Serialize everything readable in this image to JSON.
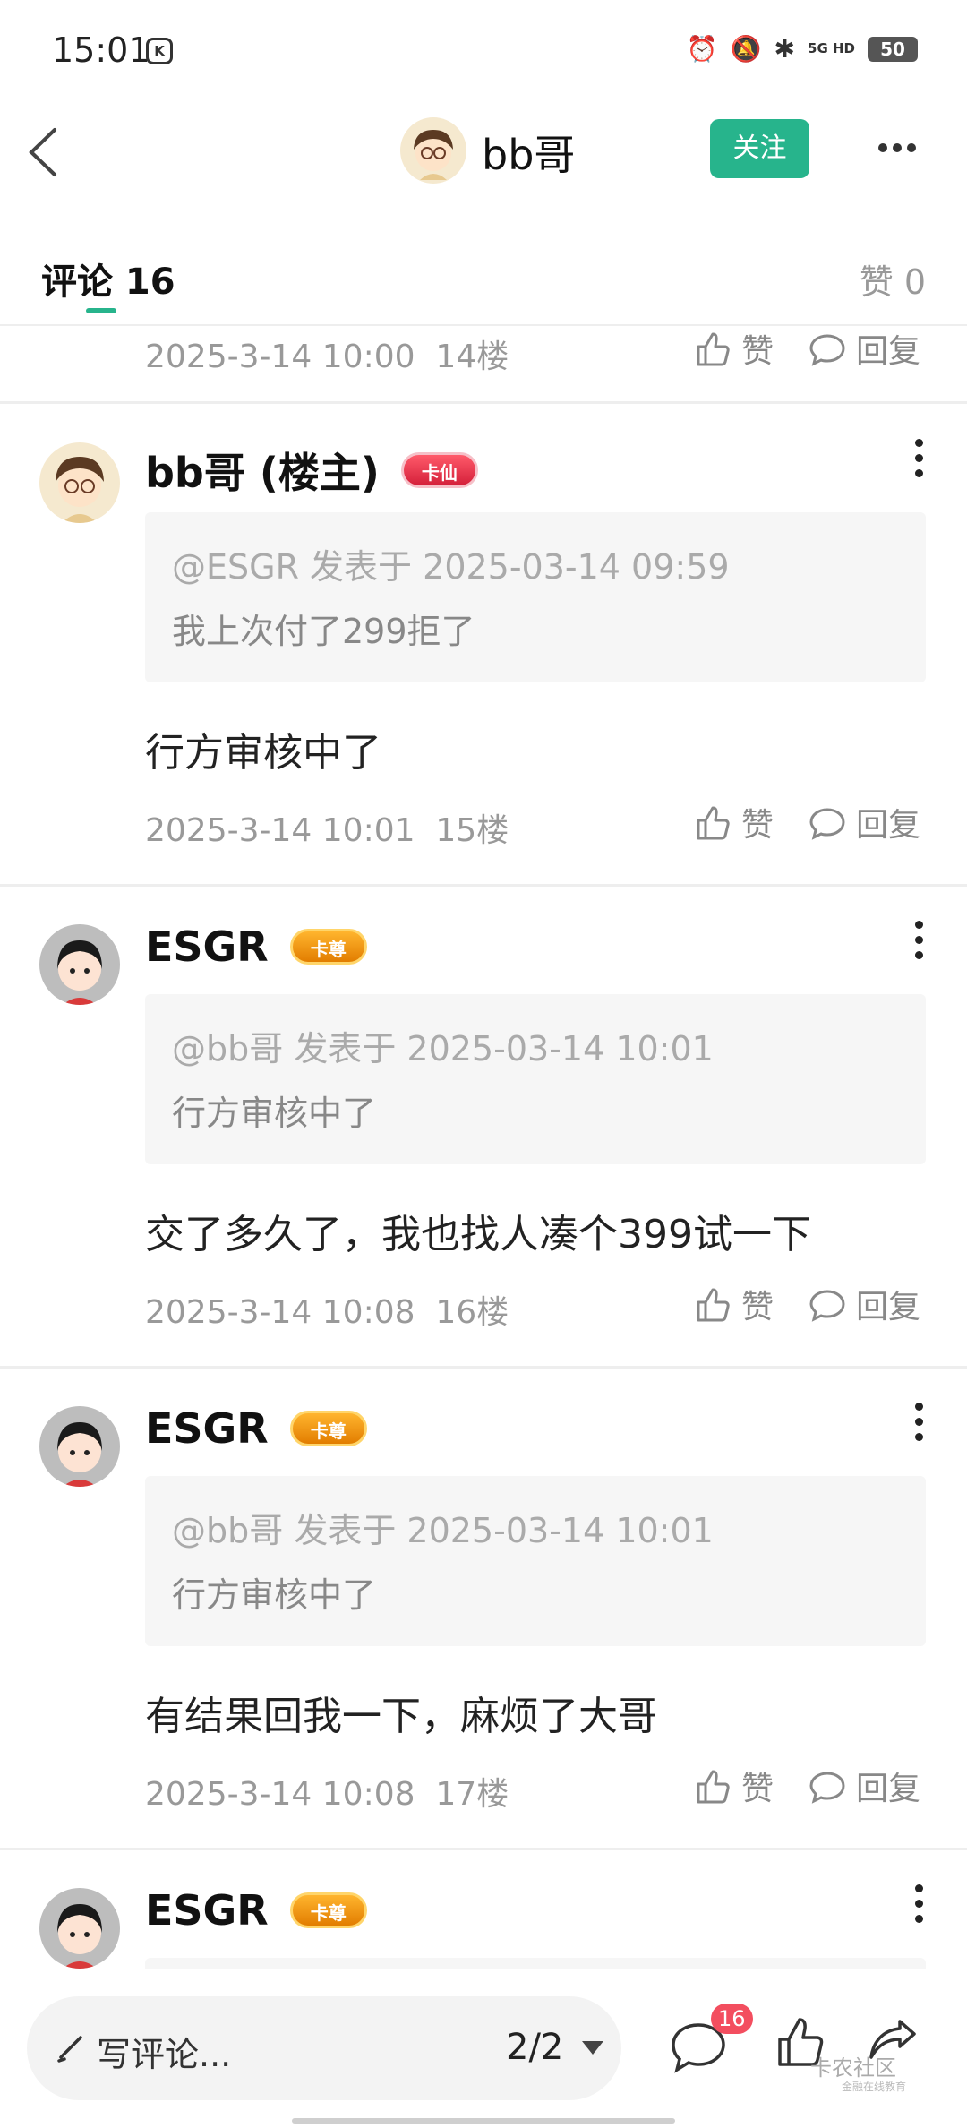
{
  "status_bar": {
    "time": "15:01",
    "network": "5G HD",
    "battery": "50"
  },
  "header": {
    "title": "bb哥",
    "follow_label": "关注"
  },
  "tabs": {
    "comments_label": "评论 16",
    "likes_label": "赞 0"
  },
  "prev_comment_tail": {
    "time": "2025-3-14 10:00",
    "floor": "14楼",
    "like_label": "赞",
    "reply_label": "回复"
  },
  "comments": [
    {
      "name": "bb哥 (楼主)",
      "badge": "卡仙",
      "quote_meta": "@ESGR 发表于 2025-03-14 09:59",
      "quote_text": "我上次付了299拒了",
      "body": "行方审核中了",
      "time": "2025-3-14 10:01",
      "floor": "15楼",
      "like_label": "赞",
      "reply_label": "回复"
    },
    {
      "name": "ESGR",
      "badge": "卡尊",
      "quote_meta": "@bb哥 发表于 2025-03-14 10:01",
      "quote_text": "行方审核中了",
      "body": "交了多久了，我也找人凑个399试一下",
      "time": "2025-3-14 10:08",
      "floor": "16楼",
      "like_label": "赞",
      "reply_label": "回复"
    },
    {
      "name": "ESGR",
      "badge": "卡尊",
      "quote_meta": "@bb哥 发表于 2025-03-14 10:01",
      "quote_text": "行方审核中了",
      "body": "有结果回我一下，麻烦了大哥",
      "time": "2025-3-14 10:08",
      "floor": "17楼",
      "like_label": "赞",
      "reply_label": "回复"
    },
    {
      "name": "ESGR",
      "badge": "卡尊"
    }
  ],
  "bottom_bar": {
    "compose_placeholder": "写评论...",
    "page_indicator": "2/2",
    "comment_count": "16",
    "watermark": "卡农社区",
    "watermark_sub": "金融在线教育"
  },
  "colors": {
    "accent": "#27b48c",
    "badge_red": "#f34e5f"
  }
}
